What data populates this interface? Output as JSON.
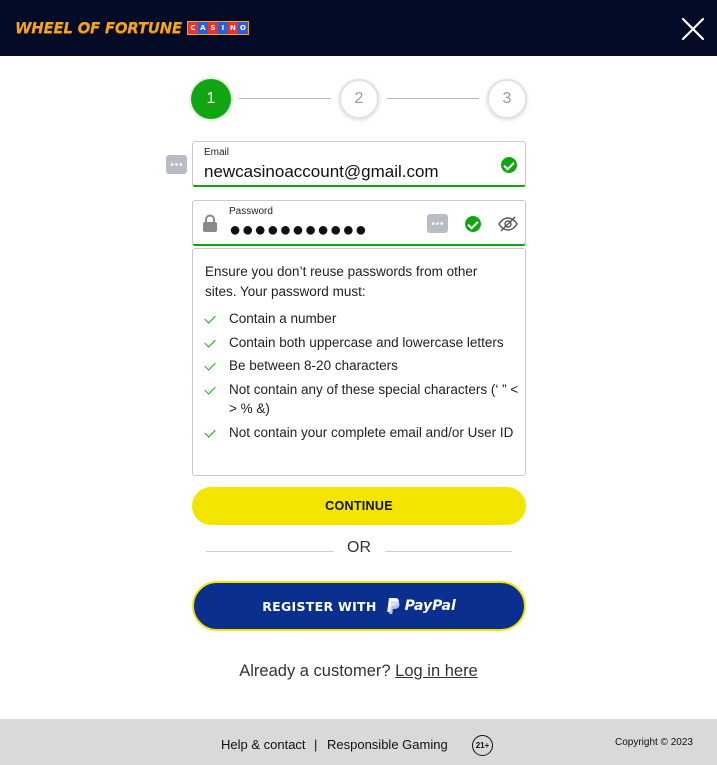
{
  "header": {
    "logo_text": "WHEEL OF FORTUNE",
    "logo_badge": [
      "C",
      "A",
      "S",
      "I",
      "N",
      "O"
    ],
    "badge_colors": [
      "#e8332b",
      "#2b5fd9",
      "#e8332b",
      "#2b5fd9",
      "#e8332b",
      "#2b5fd9"
    ],
    "close_icon": "close-icon"
  },
  "stepper": {
    "steps": [
      "1",
      "2",
      "3"
    ],
    "active_step": 1
  },
  "email": {
    "label": "Email",
    "value": "newcasinoaccount@gmail.com"
  },
  "password": {
    "label": "Password",
    "value": "●●●●●●●●●●●"
  },
  "rules": {
    "intro": "Ensure you don’t reuse passwords from other sites. Your password must:",
    "items": [
      "Contain a number",
      "Contain both uppercase and lowercase letters",
      "Be between 8-20 characters",
      "Not contain any of these special characters (‘ ” < > % &)",
      "Not contain your complete email and/or User ID"
    ]
  },
  "continue_label": "CONTINUE",
  "or_label": "OR",
  "paypal": {
    "label": "REGISTER WITH",
    "brand": "PayPal"
  },
  "login": {
    "prompt": "Already a customer?",
    "link": "Log in here"
  },
  "footer": {
    "help": "Help & contact",
    "separator": "|",
    "responsible": "Responsible Gaming",
    "age": "21+",
    "copyright": "Copyright © 2023"
  },
  "colors": {
    "accent_green": "#12a512",
    "button_yellow": "#f2e600",
    "paypal_blue": "#0a2f8f",
    "header_bg": "#040b26"
  }
}
